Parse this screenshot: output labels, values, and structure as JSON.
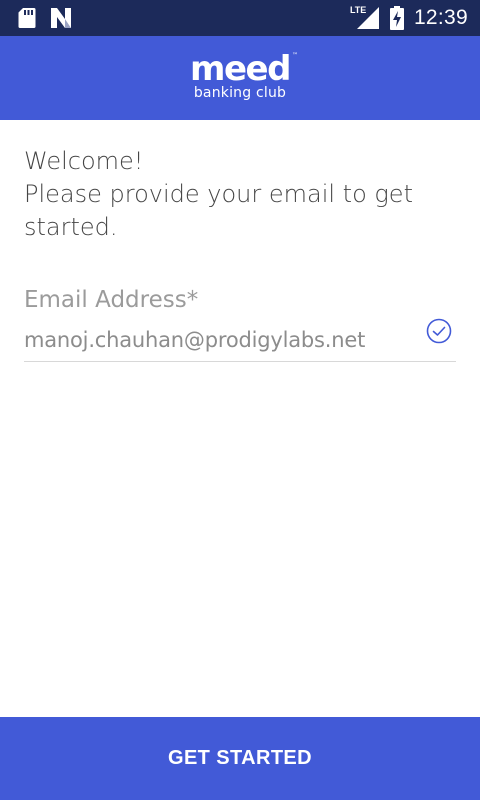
{
  "status_bar": {
    "time": "12:39",
    "network_label": "LTE",
    "icons": [
      "sd-card-icon",
      "n-notification-icon",
      "lte-signal-icon",
      "battery-charging-icon"
    ]
  },
  "header": {
    "logo_wordmark": "meed",
    "logo_trademark": "™",
    "logo_tagline": "banking club"
  },
  "welcome": {
    "line1": "Welcome!",
    "line2": "Please provide your email to get started."
  },
  "email_field": {
    "label": "Email Address*",
    "value": "manoj.chauhan@prodigylabs.net",
    "valid_icon": "check-circle-icon"
  },
  "footer": {
    "button_label": "GET STARTED"
  },
  "colors": {
    "status_bar": "#1c2a5a",
    "brand": "#425ad7",
    "text": "#454545",
    "muted": "#9b9b9b",
    "divider": "#d8d8d8"
  }
}
